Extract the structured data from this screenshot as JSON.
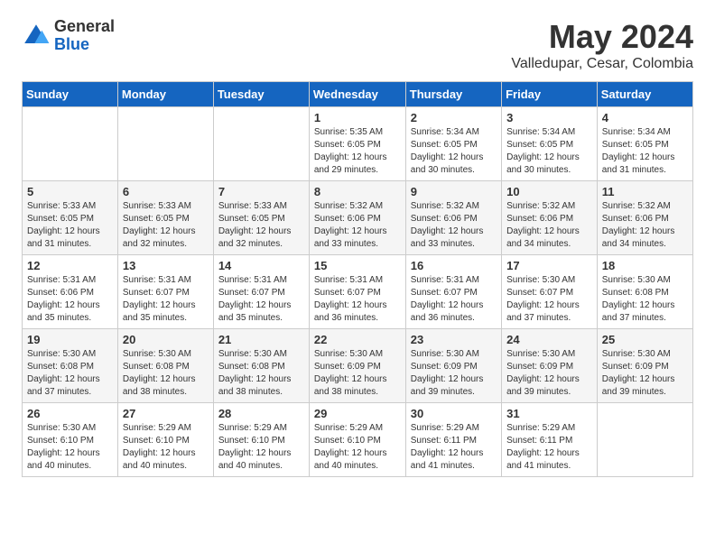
{
  "header": {
    "logo_general": "General",
    "logo_blue": "Blue",
    "title": "May 2024",
    "subtitle": "Valledupar, Cesar, Colombia"
  },
  "weekdays": [
    "Sunday",
    "Monday",
    "Tuesday",
    "Wednesday",
    "Thursday",
    "Friday",
    "Saturday"
  ],
  "rows": [
    [
      {
        "day": "",
        "info": ""
      },
      {
        "day": "",
        "info": ""
      },
      {
        "day": "",
        "info": ""
      },
      {
        "day": "1",
        "info": "Sunrise: 5:35 AM\nSunset: 6:05 PM\nDaylight: 12 hours\nand 29 minutes."
      },
      {
        "day": "2",
        "info": "Sunrise: 5:34 AM\nSunset: 6:05 PM\nDaylight: 12 hours\nand 30 minutes."
      },
      {
        "day": "3",
        "info": "Sunrise: 5:34 AM\nSunset: 6:05 PM\nDaylight: 12 hours\nand 30 minutes."
      },
      {
        "day": "4",
        "info": "Sunrise: 5:34 AM\nSunset: 6:05 PM\nDaylight: 12 hours\nand 31 minutes."
      }
    ],
    [
      {
        "day": "5",
        "info": "Sunrise: 5:33 AM\nSunset: 6:05 PM\nDaylight: 12 hours\nand 31 minutes."
      },
      {
        "day": "6",
        "info": "Sunrise: 5:33 AM\nSunset: 6:05 PM\nDaylight: 12 hours\nand 32 minutes."
      },
      {
        "day": "7",
        "info": "Sunrise: 5:33 AM\nSunset: 6:05 PM\nDaylight: 12 hours\nand 32 minutes."
      },
      {
        "day": "8",
        "info": "Sunrise: 5:32 AM\nSunset: 6:06 PM\nDaylight: 12 hours\nand 33 minutes."
      },
      {
        "day": "9",
        "info": "Sunrise: 5:32 AM\nSunset: 6:06 PM\nDaylight: 12 hours\nand 33 minutes."
      },
      {
        "day": "10",
        "info": "Sunrise: 5:32 AM\nSunset: 6:06 PM\nDaylight: 12 hours\nand 34 minutes."
      },
      {
        "day": "11",
        "info": "Sunrise: 5:32 AM\nSunset: 6:06 PM\nDaylight: 12 hours\nand 34 minutes."
      }
    ],
    [
      {
        "day": "12",
        "info": "Sunrise: 5:31 AM\nSunset: 6:06 PM\nDaylight: 12 hours\nand 35 minutes."
      },
      {
        "day": "13",
        "info": "Sunrise: 5:31 AM\nSunset: 6:07 PM\nDaylight: 12 hours\nand 35 minutes."
      },
      {
        "day": "14",
        "info": "Sunrise: 5:31 AM\nSunset: 6:07 PM\nDaylight: 12 hours\nand 35 minutes."
      },
      {
        "day": "15",
        "info": "Sunrise: 5:31 AM\nSunset: 6:07 PM\nDaylight: 12 hours\nand 36 minutes."
      },
      {
        "day": "16",
        "info": "Sunrise: 5:31 AM\nSunset: 6:07 PM\nDaylight: 12 hours\nand 36 minutes."
      },
      {
        "day": "17",
        "info": "Sunrise: 5:30 AM\nSunset: 6:07 PM\nDaylight: 12 hours\nand 37 minutes."
      },
      {
        "day": "18",
        "info": "Sunrise: 5:30 AM\nSunset: 6:08 PM\nDaylight: 12 hours\nand 37 minutes."
      }
    ],
    [
      {
        "day": "19",
        "info": "Sunrise: 5:30 AM\nSunset: 6:08 PM\nDaylight: 12 hours\nand 37 minutes."
      },
      {
        "day": "20",
        "info": "Sunrise: 5:30 AM\nSunset: 6:08 PM\nDaylight: 12 hours\nand 38 minutes."
      },
      {
        "day": "21",
        "info": "Sunrise: 5:30 AM\nSunset: 6:08 PM\nDaylight: 12 hours\nand 38 minutes."
      },
      {
        "day": "22",
        "info": "Sunrise: 5:30 AM\nSunset: 6:09 PM\nDaylight: 12 hours\nand 38 minutes."
      },
      {
        "day": "23",
        "info": "Sunrise: 5:30 AM\nSunset: 6:09 PM\nDaylight: 12 hours\nand 39 minutes."
      },
      {
        "day": "24",
        "info": "Sunrise: 5:30 AM\nSunset: 6:09 PM\nDaylight: 12 hours\nand 39 minutes."
      },
      {
        "day": "25",
        "info": "Sunrise: 5:30 AM\nSunset: 6:09 PM\nDaylight: 12 hours\nand 39 minutes."
      }
    ],
    [
      {
        "day": "26",
        "info": "Sunrise: 5:30 AM\nSunset: 6:10 PM\nDaylight: 12 hours\nand 40 minutes."
      },
      {
        "day": "27",
        "info": "Sunrise: 5:29 AM\nSunset: 6:10 PM\nDaylight: 12 hours\nand 40 minutes."
      },
      {
        "day": "28",
        "info": "Sunrise: 5:29 AM\nSunset: 6:10 PM\nDaylight: 12 hours\nand 40 minutes."
      },
      {
        "day": "29",
        "info": "Sunrise: 5:29 AM\nSunset: 6:10 PM\nDaylight: 12 hours\nand 40 minutes."
      },
      {
        "day": "30",
        "info": "Sunrise: 5:29 AM\nSunset: 6:11 PM\nDaylight: 12 hours\nand 41 minutes."
      },
      {
        "day": "31",
        "info": "Sunrise: 5:29 AM\nSunset: 6:11 PM\nDaylight: 12 hours\nand 41 minutes."
      },
      {
        "day": "",
        "info": ""
      }
    ]
  ]
}
